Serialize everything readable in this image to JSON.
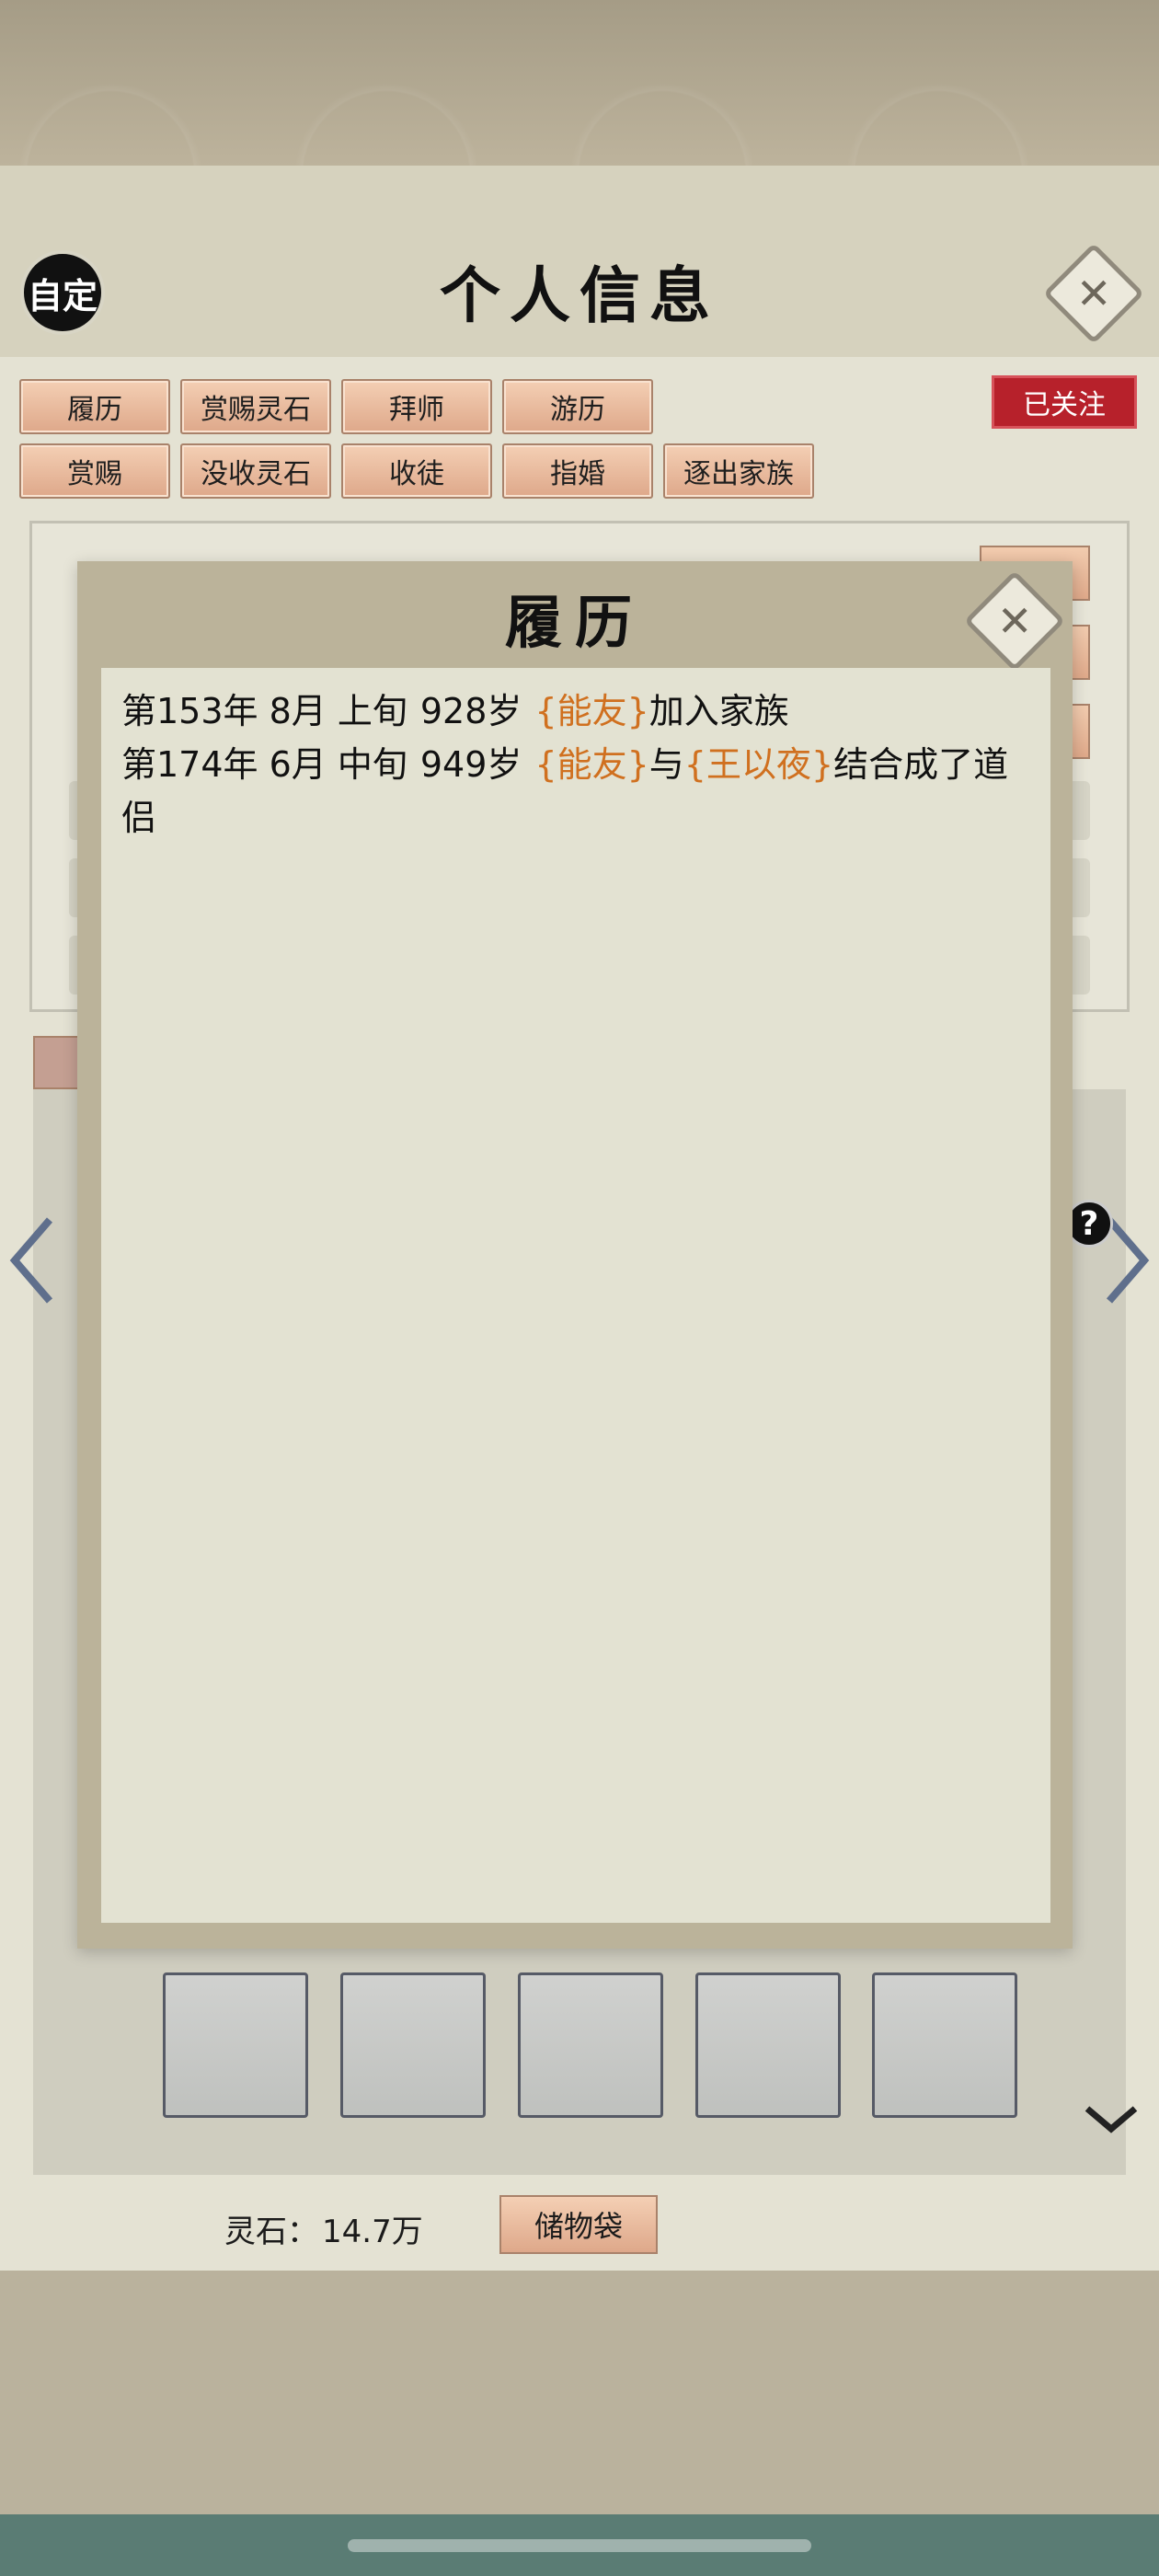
{
  "header": {
    "auto_label": "自定",
    "title": "个人信息"
  },
  "actions": {
    "row1": [
      "履历",
      "赏赐灵石",
      "拜师",
      "游历"
    ],
    "row2": [
      "赏赐",
      "没收灵石",
      "收徒",
      "指婚",
      "逐出家族"
    ]
  },
  "follow_badge": "已关注",
  "icons": {
    "auto": "auto-icon",
    "close": "close-icon",
    "help": "help-icon",
    "prev": "arrow-left-icon",
    "next": "arrow-right-icon",
    "expand": "chevron-down-icon"
  },
  "footer": {
    "currency_label": "灵石：",
    "currency_value": "14.7万",
    "bag_button": "储物袋"
  },
  "modal": {
    "title": "履历",
    "entries": [
      {
        "date": "第153年 8月 上旬",
        "age": "928岁",
        "name1": "{能友}",
        "mid": "加入家族"
      },
      {
        "date": "第174年 6月 中旬",
        "age": "949岁",
        "name1": "{能友}",
        "mid": "与",
        "name2": "{王以夜}",
        "end": "结合成了道侣"
      }
    ]
  },
  "colors": {
    "highlight": "#d0701f",
    "badge_red": "#b7212b",
    "button_peach": "#f4cfb4"
  }
}
